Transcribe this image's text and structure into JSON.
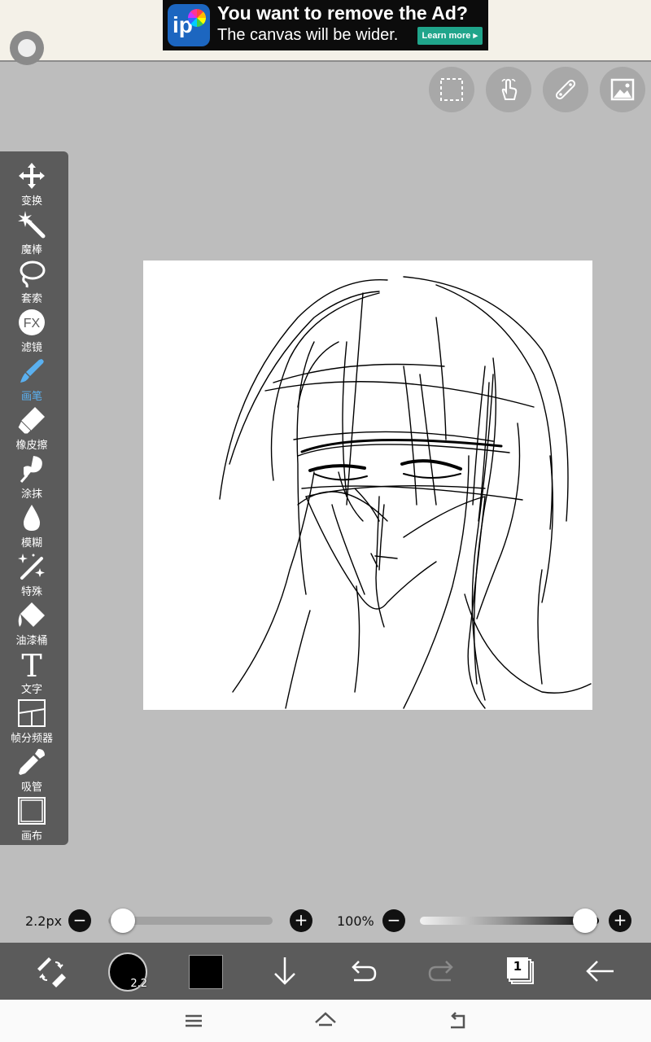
{
  "ad": {
    "title": "You want to remove the Ad?",
    "subtitle": "The canvas will be wider.",
    "button": "Learn more ▸"
  },
  "toolbar": {
    "tools": [
      {
        "label": "变换",
        "icon": "move-icon"
      },
      {
        "label": "魔棒",
        "icon": "magic-wand-icon"
      },
      {
        "label": "套索",
        "icon": "lasso-icon"
      },
      {
        "label": "滤镜",
        "icon": "fx-icon"
      },
      {
        "label": "画笔",
        "icon": "brush-icon",
        "active": true
      },
      {
        "label": "橡皮擦",
        "icon": "eraser-icon"
      },
      {
        "label": "涂抹",
        "icon": "smudge-icon"
      },
      {
        "label": "模糊",
        "icon": "blur-drop-icon"
      },
      {
        "label": "特殊",
        "icon": "sparkle-wand-icon"
      },
      {
        "label": "油漆桶",
        "icon": "paint-bucket-icon"
      },
      {
        "label": "文字",
        "icon": "text-icon"
      },
      {
        "label": "帧分频器",
        "icon": "frame-divider-icon"
      },
      {
        "label": "吸管",
        "icon": "eyedropper-icon"
      },
      {
        "label": "画布",
        "icon": "canvas-icon"
      }
    ]
  },
  "brush": {
    "size_label": "2.2px",
    "size_badge": "2.2",
    "opacity_label": "100%",
    "opacity": 1.0,
    "color": "#000000"
  },
  "layers": {
    "count": "1"
  },
  "colors": {
    "accent": "#5ab0f0",
    "toolbar": "#5b5b5b",
    "background": "#bdbdbd"
  }
}
